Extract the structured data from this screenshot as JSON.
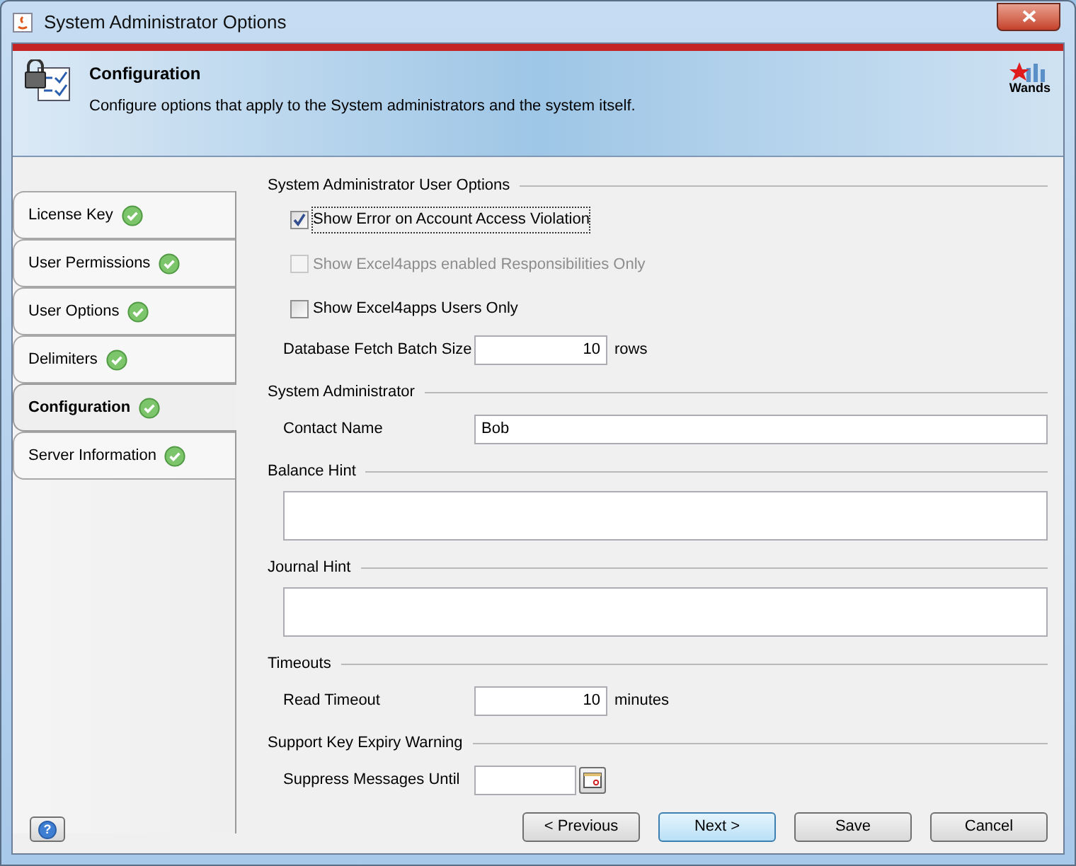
{
  "window": {
    "title": "System Administrator Options"
  },
  "header": {
    "title": "Configuration",
    "description": "Configure options that apply to the System administrators and the system itself.",
    "logo_text": "Wands"
  },
  "tabs": [
    {
      "label": "License Key",
      "selected": false
    },
    {
      "label": "User Permissions",
      "selected": false
    },
    {
      "label": "User Options",
      "selected": false
    },
    {
      "label": "Delimiters",
      "selected": false
    },
    {
      "label": "Configuration",
      "selected": true
    },
    {
      "label": "Server Information",
      "selected": false
    }
  ],
  "sections": [
    {
      "title": "System Administrator User Options",
      "items": [
        {
          "kind": "checkbox",
          "label": "Show Error on Account Access Violation",
          "checked": true,
          "disabled": false
        },
        {
          "kind": "checkbox",
          "label": "Show Excel4apps enabled Responsibilities Only",
          "checked": false,
          "disabled": true
        },
        {
          "kind": "checkbox",
          "label": "Show Excel4apps Users Only",
          "checked": false,
          "disabled": false
        },
        {
          "kind": "number",
          "label": "Database Fetch Batch Size",
          "value": "10",
          "unit": "rows"
        }
      ]
    },
    {
      "title": "System Administrator",
      "items": [
        {
          "kind": "text",
          "label": "Contact Name",
          "value": "Bob"
        }
      ]
    },
    {
      "title": "Balance Hint",
      "items": [
        {
          "kind": "textarea"
        }
      ]
    },
    {
      "title": "Journal Hint",
      "items": [
        {
          "kind": "textarea"
        }
      ]
    },
    {
      "title": "Timeouts",
      "items": [
        {
          "kind": "number",
          "label": "Read Timeout",
          "value": "10",
          "unit": "minutes"
        }
      ]
    },
    {
      "title": "Support Key Expiry Warning",
      "items": [
        {
          "kind": "date",
          "label": "Suppress Messages Until"
        }
      ]
    }
  ],
  "help_button": {
    "label": "?"
  },
  "buttons": [
    {
      "label": "< Previous",
      "default": false
    },
    {
      "label": "Next >",
      "default": true
    },
    {
      "label": "Save",
      "default": false
    },
    {
      "label": "Cancel",
      "default": false
    }
  ]
}
